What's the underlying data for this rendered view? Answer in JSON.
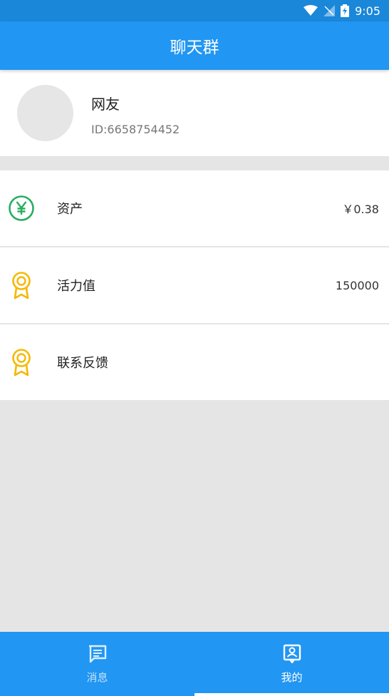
{
  "status_bar": {
    "time": "9:05"
  },
  "app_bar": {
    "title": "聊天群"
  },
  "profile": {
    "nickname": "网友",
    "user_id": "ID:6658754452"
  },
  "menu": [
    {
      "icon": "yen-circle-icon",
      "label": "资产",
      "value": "￥0.38",
      "icon_color": "#27ae60"
    },
    {
      "icon": "medal-icon",
      "label": "活力值",
      "value": "150000",
      "icon_color": "#f5b800"
    },
    {
      "icon": "medal-icon",
      "label": "联系反馈",
      "value": "",
      "icon_color": "#f5b800"
    }
  ],
  "bottom_nav": {
    "tabs": [
      {
        "icon": "message-icon",
        "label": "消息",
        "active": false
      },
      {
        "icon": "profile-icon",
        "label": "我的",
        "active": true
      }
    ]
  },
  "colors": {
    "primary": "#2196f3",
    "status_bar": "#1a87d9",
    "background": "#e5e5e5"
  }
}
